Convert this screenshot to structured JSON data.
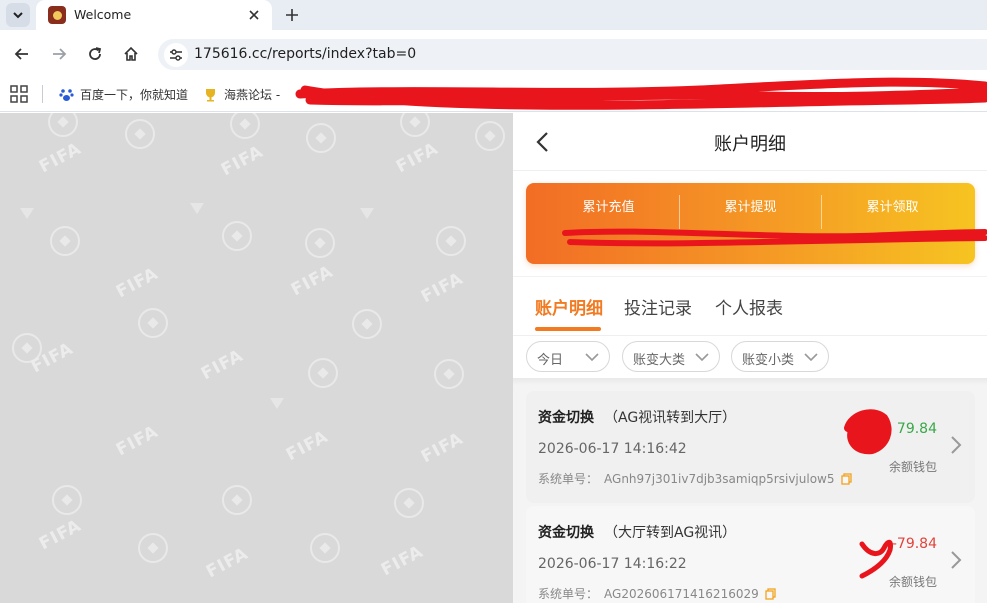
{
  "browser": {
    "tab": {
      "title": "Welcome"
    },
    "url": "175616.cc/reports/index?tab=0",
    "bookmarks": [
      {
        "label": "百度一下，你就知道"
      },
      {
        "label": "海燕论坛 -"
      }
    ]
  },
  "panel": {
    "title": "账户明细",
    "summary": [
      {
        "label": "累计充值"
      },
      {
        "label": "累计提现"
      },
      {
        "label": "累计领取"
      }
    ],
    "tabs": [
      {
        "label": "账户明细",
        "active": true
      },
      {
        "label": "投注记录",
        "active": false
      },
      {
        "label": "个人报表",
        "active": false
      }
    ],
    "filters": [
      {
        "label": "今日"
      },
      {
        "label": "账变大类"
      },
      {
        "label": "账变小类"
      }
    ],
    "records": [
      {
        "type": "资金切换",
        "detail": "（AG视讯转到大厅）",
        "time": "2026-06-17 14:16:42",
        "order_label": "系统单号：",
        "order_no": "AGnh97j301iv7djb3samiqp5rsivjulow5",
        "amount": "79.84",
        "amount_sign": "positive",
        "wallet": "余额钱包"
      },
      {
        "type": "资金切换",
        "detail": "（大厅转到AG视讯）",
        "time": "2026-06-17 14:16:22",
        "order_label": "系统单号：",
        "order_no": "AG202606171416216029",
        "amount": "-79.84",
        "amount_sign": "negative",
        "wallet": "余额钱包"
      }
    ]
  },
  "colors": {
    "accent": "#f27a21",
    "positive": "#39a84a",
    "negative": "#e0443c",
    "redaction": "#e8161c"
  }
}
